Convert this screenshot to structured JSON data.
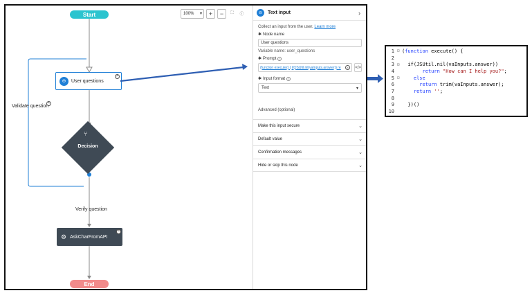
{
  "canvas": {
    "toolbar": {
      "zoom": "100%",
      "zoom_in": "+",
      "zoom_out": "−"
    },
    "start_label": "Start",
    "end_label": "End",
    "user_node": {
      "label": "User questions"
    },
    "decision_node": {
      "label": "Decision"
    },
    "ask_node": {
      "label": "AskCharFromAPI"
    },
    "loop_label": "Validate question",
    "edge_label": "Verify question"
  },
  "panel": {
    "title": "Text input",
    "description": "Collect an input from the user.",
    "learn_more": "Learn more",
    "node_name_label": "Node name",
    "node_name_value": "User questions",
    "variable_name": "Variable name: user_questions",
    "prompt_label": "Prompt",
    "prompt_value": "(function execute() { if(JSUtil.nil(vaInputs.answer)) re",
    "input_format_label": "Input format",
    "input_format_value": "Text",
    "advanced_label": "Advanced (optional)",
    "accordions": [
      "Make this input secure",
      "Default value",
      "Confirmation messages",
      "Hide or skip this node"
    ]
  },
  "code": {
    "lines": [
      {
        "n": "1",
        "fold": "⊟",
        "parts": [
          {
            "t": "(",
            "c": "txt"
          },
          {
            "t": "function",
            "c": "kw"
          },
          {
            "t": " execute() {",
            "c": "txt"
          }
        ]
      },
      {
        "n": "2",
        "fold": "",
        "parts": []
      },
      {
        "n": "3",
        "fold": "⊟",
        "parts": [
          {
            "t": "  if(JSUtil.nil(vaInputs.answer))",
            "c": "txt"
          }
        ]
      },
      {
        "n": "4",
        "fold": "",
        "parts": [
          {
            "t": "       ",
            "c": "txt"
          },
          {
            "t": "return",
            "c": "kw"
          },
          {
            "t": " ",
            "c": "txt"
          },
          {
            "t": "\"How can I help you?\"",
            "c": "str"
          },
          {
            "t": ";",
            "c": "txt"
          }
        ]
      },
      {
        "n": "5",
        "fold": "⊟",
        "parts": [
          {
            "t": "    ",
            "c": "txt"
          },
          {
            "t": "else",
            "c": "kw"
          }
        ]
      },
      {
        "n": "6",
        "fold": "",
        "parts": [
          {
            "t": "      ",
            "c": "txt"
          },
          {
            "t": "return",
            "c": "kw"
          },
          {
            "t": " trim(vaInputs.answer);",
            "c": "txt"
          }
        ]
      },
      {
        "n": "7",
        "fold": "",
        "parts": [
          {
            "t": "    ",
            "c": "txt"
          },
          {
            "t": "return",
            "c": "kw"
          },
          {
            "t": " ",
            "c": "txt"
          },
          {
            "t": "''",
            "c": "str"
          },
          {
            "t": ";",
            "c": "txt"
          }
        ]
      },
      {
        "n": "8",
        "fold": "",
        "parts": []
      },
      {
        "n": "9",
        "fold": "",
        "parts": [
          {
            "t": "  })()",
            "c": "txt"
          }
        ]
      },
      {
        "n": "10",
        "fold": "",
        "parts": []
      }
    ]
  },
  "colors": {
    "accent": "#1f7fd6",
    "start": "#2bc4cf",
    "end": "#f28b8b",
    "node_dark": "#3f4a55",
    "arrow": "#2f5fb3"
  }
}
